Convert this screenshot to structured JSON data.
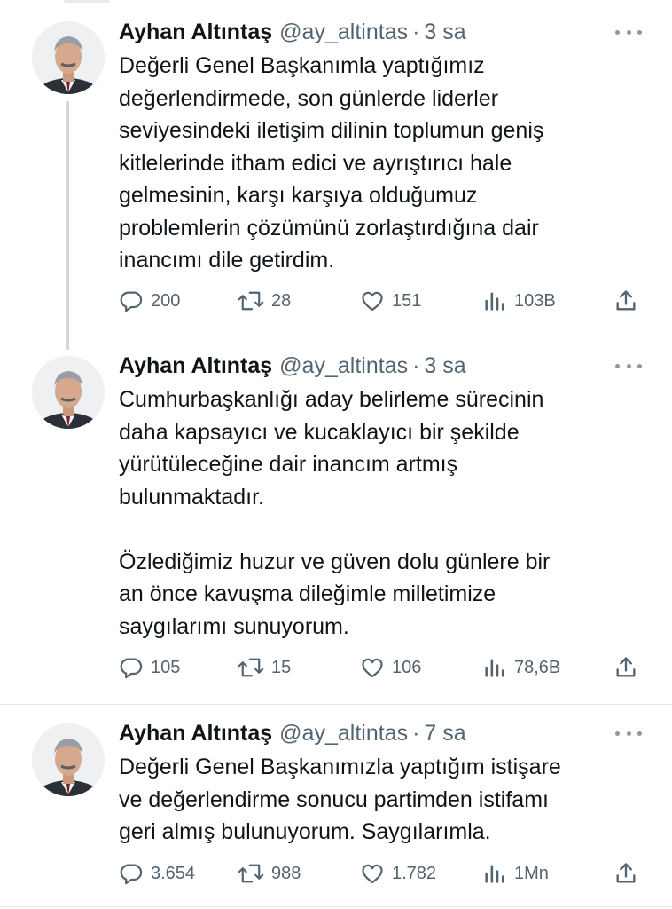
{
  "tweets": [
    {
      "name": "Ayhan Altıntaş",
      "handle": "@ay_altintas",
      "separator": "·",
      "time": "3 sa",
      "text": "Değerli Genel Başkanımla yaptığımız\ndeğerlendirmede, son günlerde liderler\nseviyesindeki iletişim dilinin toplumun geniş\nkitlelerinde itham edici ve ayrıştırıcı hale\ngelmesinin, karşı karşıya olduğumuz\nproblemlerin çözümünü zorlaştırdığına dair\ninancımı dile getirdim.",
      "replies": "200",
      "retweets": "28",
      "likes": "151",
      "views": "103B"
    },
    {
      "name": "Ayhan Altıntaş",
      "handle": "@ay_altintas",
      "separator": "·",
      "time": "3 sa",
      "text": "Cumhurbaşkanlığı aday belirleme sürecinin\ndaha kapsayıcı ve kucaklayıcı bir şekilde\nyürütüleceğine dair inancım artmış\nbulunmaktadır.\n\nÖzlediğimiz huzur ve güven dolu günlere bir\nan önce kavuşma  dileğimle milletimize\nsaygılarımı sunuyorum.",
      "replies": "105",
      "retweets": "15",
      "likes": "106",
      "views": "78,6B"
    },
    {
      "name": "Ayhan Altıntaş",
      "handle": "@ay_altintas",
      "separator": "·",
      "time": "7 sa",
      "text": "Değerli Genel Başkanımızla yaptığım istişare\nve değerlendirme sonucu partimden istifamı\ngeri almış bulunuyorum. Saygılarımla.",
      "replies": "3.654",
      "retweets": "988",
      "likes": "1.782",
      "views": "1Mn"
    }
  ],
  "icons": {
    "reply": "reply-icon",
    "retweet": "retweet-icon",
    "like": "heart-icon",
    "views": "views-icon",
    "share": "share-icon",
    "more": "more-icon"
  },
  "colors": {
    "text": "#0f1419",
    "secondary": "#536471",
    "thread_line": "#cfd9de",
    "divider": "#e6e8ea"
  }
}
